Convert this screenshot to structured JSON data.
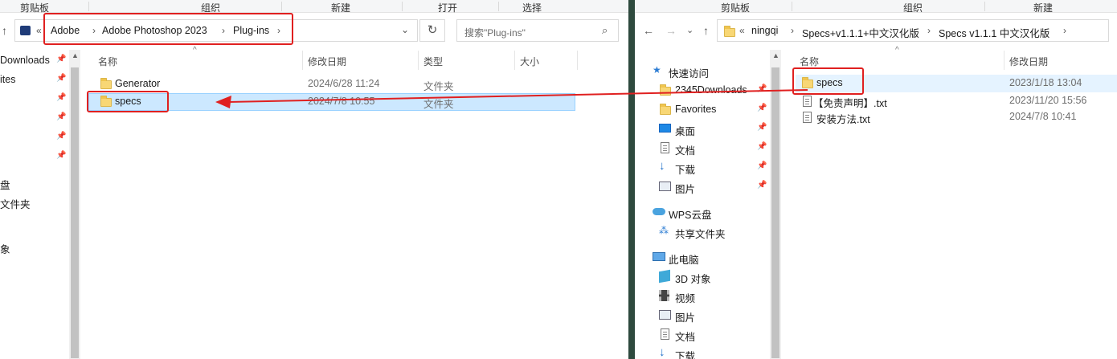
{
  "left": {
    "ribbon": [
      "剪贴板",
      "组织",
      "新建",
      "打开",
      "选择"
    ],
    "breadcrumb": [
      "Adobe",
      "Adobe Photoshop 2023",
      "Plug-ins"
    ],
    "search_placeholder": "搜索\"Plug-ins\"",
    "columns": [
      "名称",
      "修改日期",
      "类型",
      "大小"
    ],
    "rows": [
      {
        "name": "Generator",
        "date": "2024/6/28 11:24",
        "type": "文件夹"
      },
      {
        "name": "specs",
        "date": "2024/7/8 10:55",
        "type": "文件夹"
      }
    ],
    "tree_partial": [
      "Downloads",
      "ites",
      "盘",
      "文件夹",
      "象"
    ]
  },
  "right": {
    "ribbon": [
      "剪贴板",
      "组织",
      "新建"
    ],
    "breadcrumb": [
      "ningqi",
      "Specs+v1.1.1+中文汉化版",
      "Specs v1.1.1 中文汉化版"
    ],
    "columns": [
      "名称",
      "修改日期"
    ],
    "rows": [
      {
        "name": "specs",
        "date": "2023/1/18 13:04",
        "icon": "folder"
      },
      {
        "name": "【免责声明】.txt",
        "date": "2023/11/20 15:56",
        "icon": "txt"
      },
      {
        "name": "安装方法.txt",
        "date": "2024/7/8 10:41",
        "icon": "txt"
      }
    ],
    "tree": {
      "quick_access": "快速访问",
      "quick_items": [
        "2345Downloads",
        "Favorites",
        "桌面",
        "文档",
        "下载",
        "图片"
      ],
      "wps": "WPS云盘",
      "shared": "共享文件夹",
      "this_pc": "此电脑",
      "pc_items": [
        "3D 对象",
        "视频",
        "图片",
        "文档",
        "下载"
      ]
    }
  },
  "colors": {
    "highlight": "#e02020",
    "selection": "#cce8ff"
  }
}
